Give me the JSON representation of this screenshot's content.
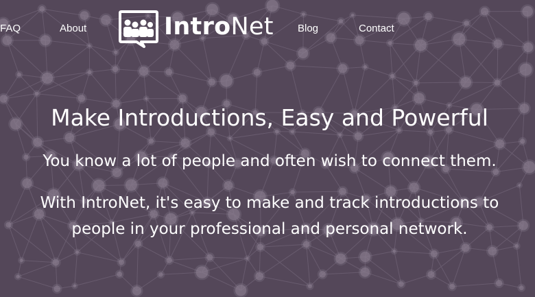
{
  "nav": {
    "faq": "FAQ",
    "about": "About",
    "blog": "Blog",
    "contact": "Contact"
  },
  "logo": {
    "part1": "Intro",
    "part2": "Net",
    "icon": "people-speech-bubble-icon"
  },
  "hero": {
    "headline": "Make Introductions, Easy and Powerful",
    "tagline": "You know a lot of people and often wish to connect them.",
    "description_line1": "With IntroNet, it's easy to make and track introductions to",
    "description_line2": "people in your professional and personal network."
  },
  "colors": {
    "background": "#544759",
    "network_lines": "#7a6d80",
    "network_nodes": "#8a7d8f",
    "text": "#ffffff"
  }
}
